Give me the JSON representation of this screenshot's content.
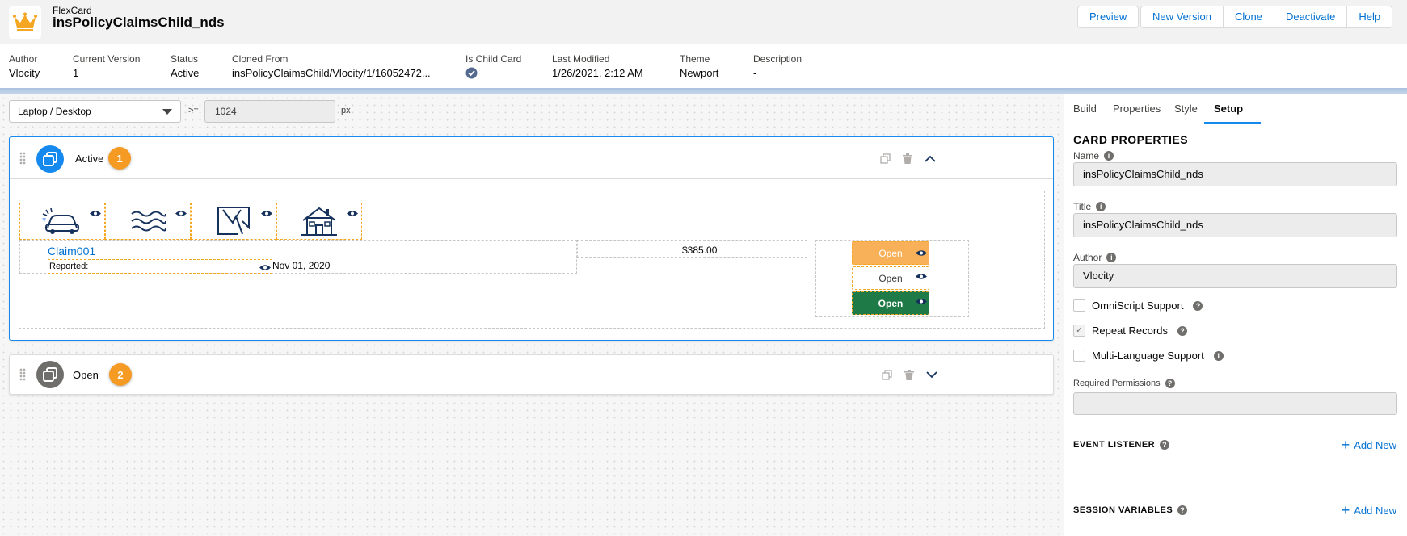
{
  "header": {
    "subtitle": "FlexCard",
    "title": "insPolicyClaimsChild_nds",
    "buttons": [
      "Preview",
      "New Version",
      "Clone",
      "Deactivate",
      "Help"
    ]
  },
  "meta": {
    "author_label": "Author",
    "author": "Vlocity",
    "version_label": "Current Version",
    "version": "1",
    "status_label": "Status",
    "status": "Active",
    "cloned_label": "Cloned From",
    "cloned": "insPolicyClaimsChild/Vlocity/1/16052472...",
    "child_label": "Is Child Card",
    "modified_label": "Last Modified",
    "modified": "1/26/2021, 2:12 AM",
    "theme_label": "Theme",
    "theme": "Newport",
    "desc_label": "Description",
    "desc": "-"
  },
  "canvas": {
    "device": "Laptop / Desktop",
    "gte": ">=",
    "breakpoint": "1024",
    "unit": "px",
    "states": [
      {
        "name": "Active",
        "badge": "1"
      },
      {
        "name": "Open",
        "badge": "2"
      }
    ],
    "claim": {
      "id": "Claim001",
      "reported_label": "Reported:",
      "date": "Nov 01, 2020",
      "amount": "$385.00",
      "buttons": [
        "Open",
        "Open",
        "Open"
      ]
    }
  },
  "panel": {
    "tabs": [
      "Build",
      "Properties",
      "Style",
      "Setup"
    ],
    "card_properties": "CARD PROPERTIES",
    "name_label": "Name",
    "name": "insPolicyClaimsChild_nds",
    "title_label": "Title",
    "title": "insPolicyClaimsChild_nds",
    "author_label": "Author",
    "author": "Vlocity",
    "checkboxes": [
      "OmniScript Support",
      "Repeat Records",
      "Multi-Language Support"
    ],
    "permissions_label": "Required Permissions",
    "event_listener": "EVENT LISTENER",
    "session_variables": "SESSION VARIABLES",
    "add_new": "Add New"
  },
  "colors": {
    "accent": "#0070d2",
    "orange": "#f59a23",
    "green": "#1e7a46",
    "select_blue": "#1589ee"
  }
}
